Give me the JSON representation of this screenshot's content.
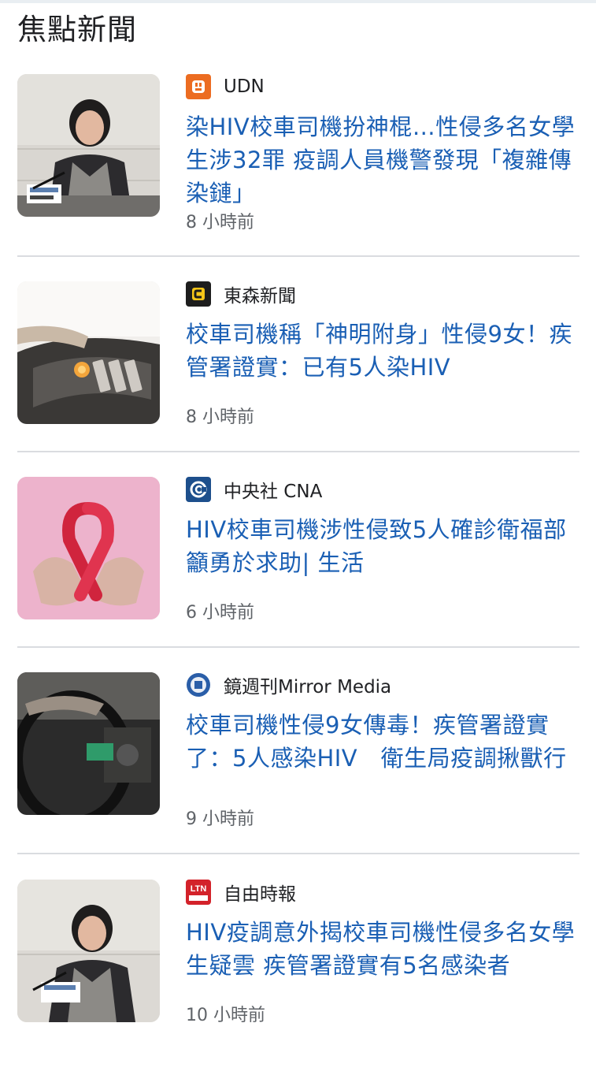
{
  "page_title": "焦點新聞",
  "articles": [
    {
      "source": "UDN",
      "source_icon": "udn-logo-icon",
      "headline": "染HIV校車司機扮神棍…性侵多名女學生涉32罪 疫調人員機警發現「複雜傳染鏈」",
      "time": "8 小時前",
      "thumbnail": "press-conference-speaker-thumbnail"
    },
    {
      "source": "東森新聞",
      "source_icon": "ettoday-logo-icon",
      "headline": "校車司機稱「神明附身」性侵9女！疾管署證實：已有5人染HIV",
      "time": "8 小時前",
      "thumbnail": "bus-driver-console-thumbnail"
    },
    {
      "source": "中央社 CNA",
      "source_icon": "cna-logo-icon",
      "headline": "HIV校車司機涉性侵致5人確診衛福部籲勇於求助| 生活",
      "time": "6 小時前",
      "thumbnail": "red-ribbon-hands-thumbnail"
    },
    {
      "source": "鏡週刊Mirror Media",
      "source_icon": "mirror-media-logo-icon",
      "headline": "校車司機性侵9女傳毒！疾管署證實了：5人感染HIV　衛生局疫調揪獸行",
      "time": "9 小時前",
      "thumbnail": "steering-wheel-thumbnail"
    },
    {
      "source": "自由時報",
      "source_icon": "ltn-logo-icon",
      "headline": "HIV疫調意外揭校車司機性侵多名女學生疑雲 疾管署證實有5名感染者",
      "time": "10 小時前",
      "thumbnail": "press-conference-speaker-thumbnail"
    }
  ],
  "logos": {
    "udn": "▪",
    "ltn": "LTN"
  },
  "colors": {
    "headline": "#1a5fb4",
    "udn": "#ec6c21",
    "ettoday": "#1d1d1d",
    "ettoday_accent": "#f5c518",
    "cna": "#1d4f8c",
    "mirror": "#2a5ea8",
    "ltn": "#d3222a"
  }
}
